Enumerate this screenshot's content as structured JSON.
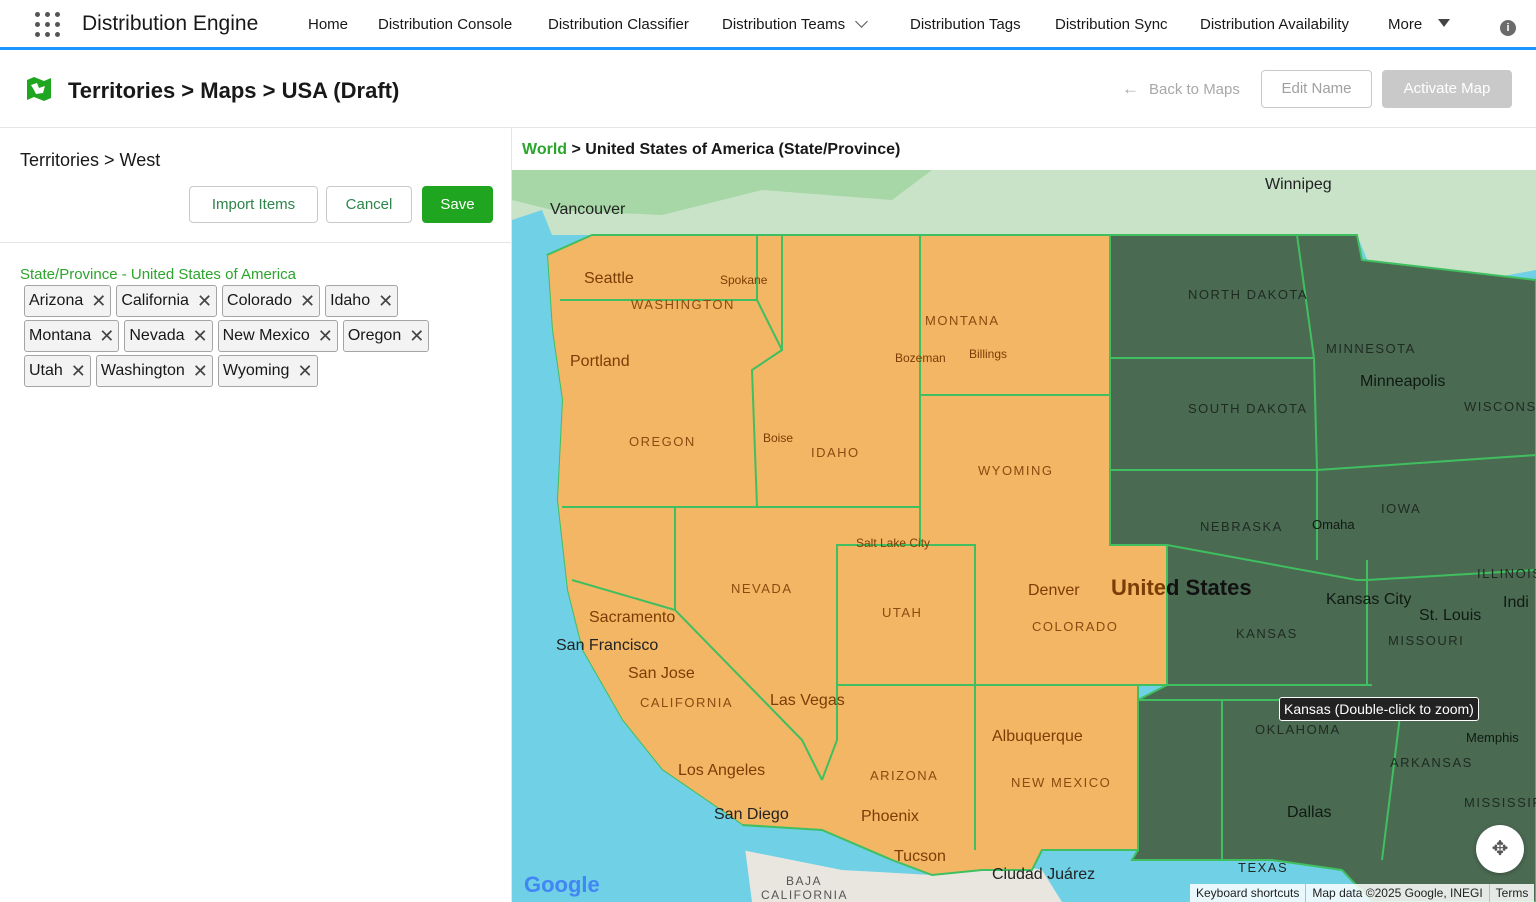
{
  "nav": {
    "app_name": "Distribution Engine",
    "items": [
      {
        "label": "Home"
      },
      {
        "label": "Distribution Console"
      },
      {
        "label": "Distribution Classifier"
      },
      {
        "label": "Distribution Teams"
      },
      {
        "label": "Distribution Tags"
      },
      {
        "label": "Distribution Sync"
      },
      {
        "label": "Distribution Availability"
      },
      {
        "label": "More"
      }
    ],
    "info_icon": "i"
  },
  "header": {
    "title": "Territories > Maps > USA (Draft)",
    "back_label": "Back to Maps",
    "back_icon": "←",
    "edit_label": "Edit Name",
    "activate_label": "Activate Map"
  },
  "left": {
    "breadcrumb": "Territories > West",
    "import_label": "Import Items",
    "cancel_label": "Cancel",
    "save_label": "Save",
    "section_label": "State/Province - United States of America",
    "remove_icon": "✕",
    "states": [
      "Arizona",
      "California",
      "Colorado",
      "Idaho",
      "Montana",
      "Nevada",
      "New Mexico",
      "Oregon",
      "Utah",
      "Washington",
      "Wyoming"
    ]
  },
  "map": {
    "breadcrumb_world": "World",
    "breadcrumb_rest": " > United States of America (State/Province)",
    "country_label_a": "Unite",
    "country_label_b": "d States",
    "tooltip": "Kansas (Double-click to zoom)",
    "google": "Google",
    "attribution": [
      "Keyboard shortcuts",
      "Map data ©2025 Google, INEGI",
      "Terms"
    ],
    "states_selected": [
      "WASHINGTON",
      "OREGON",
      "IDAHO",
      "MONTANA",
      "WYOMING",
      "NEVADA",
      "UTAH",
      "COLORADO",
      "CALIFORNIA",
      "ARIZONA",
      "NEW MEXICO"
    ],
    "states_other": [
      "NORTH DAKOTA",
      "SOUTH DAKOTA",
      "NEBRASKA",
      "KANSAS",
      "OKLAHOMA",
      "TEXAS",
      "MINNESOTA",
      "IOWA",
      "MISSOURI",
      "ARKANSAS",
      "WISCONSI",
      "ILLINOIS",
      "Indi",
      "MISSISSIP"
    ],
    "cities": [
      "Vancouver",
      "Winnipeg",
      "Seattle",
      "Spokane",
      "Portland",
      "Bozeman",
      "Billings",
      "Boise",
      "Salt Lake City",
      "Denver",
      "Sacramento",
      "San Francisco",
      "San Jose",
      "Las Vegas",
      "Los Angeles",
      "San Diego",
      "Phoenix",
      "Tucson",
      "Albuquerque",
      "Ciudad Juárez",
      "Minneapolis",
      "Omaha",
      "Kansas City",
      "St. Louis",
      "Memphis",
      "Dallas",
      "BAJA",
      "CALIFORNIA"
    ],
    "colors": {
      "selected_fill": "#f3b664",
      "other_fill": "#4b6a52",
      "border": "#3fbf5f",
      "water": "#6fd0e6"
    }
  }
}
